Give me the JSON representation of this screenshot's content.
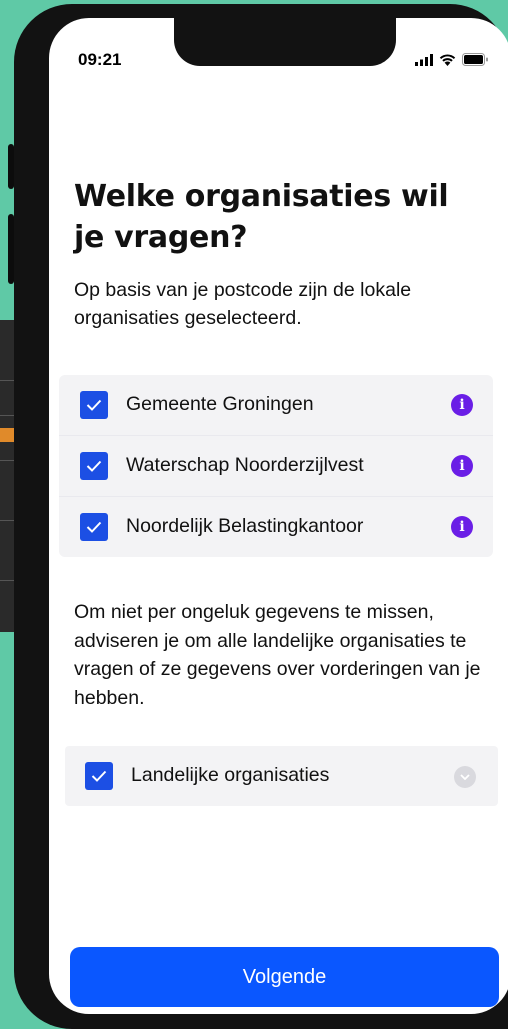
{
  "status_bar": {
    "time": "09:21"
  },
  "page": {
    "title": "Welke organisaties wil je vragen?",
    "intro": "Op basis van je postcode zijn de lokale organisaties geselecteerd."
  },
  "organisations": [
    {
      "label": "Gemeente Groningen",
      "checked": true
    },
    {
      "label": "Waterschap Noorderzijlvest",
      "checked": true
    },
    {
      "label": "Noordelijk Belastingkantoor",
      "checked": true
    }
  ],
  "advice": "Om niet per ongeluk gegevens te missen, adviseren je om alle landelijke organisaties te vragen of ze gegevens over vorderingen van je hebben.",
  "national": {
    "label": "Landelijke organisaties",
    "checked": true
  },
  "next_button": {
    "label": "Volgende"
  },
  "icons": {
    "info": "info-icon",
    "check": "checkmark-icon",
    "expand": "chevron-down-icon"
  },
  "colors": {
    "primary": "#0a57ff",
    "checkbox": "#1c4fe4",
    "info": "#6a1ee6",
    "background": "#5fc9a6"
  }
}
